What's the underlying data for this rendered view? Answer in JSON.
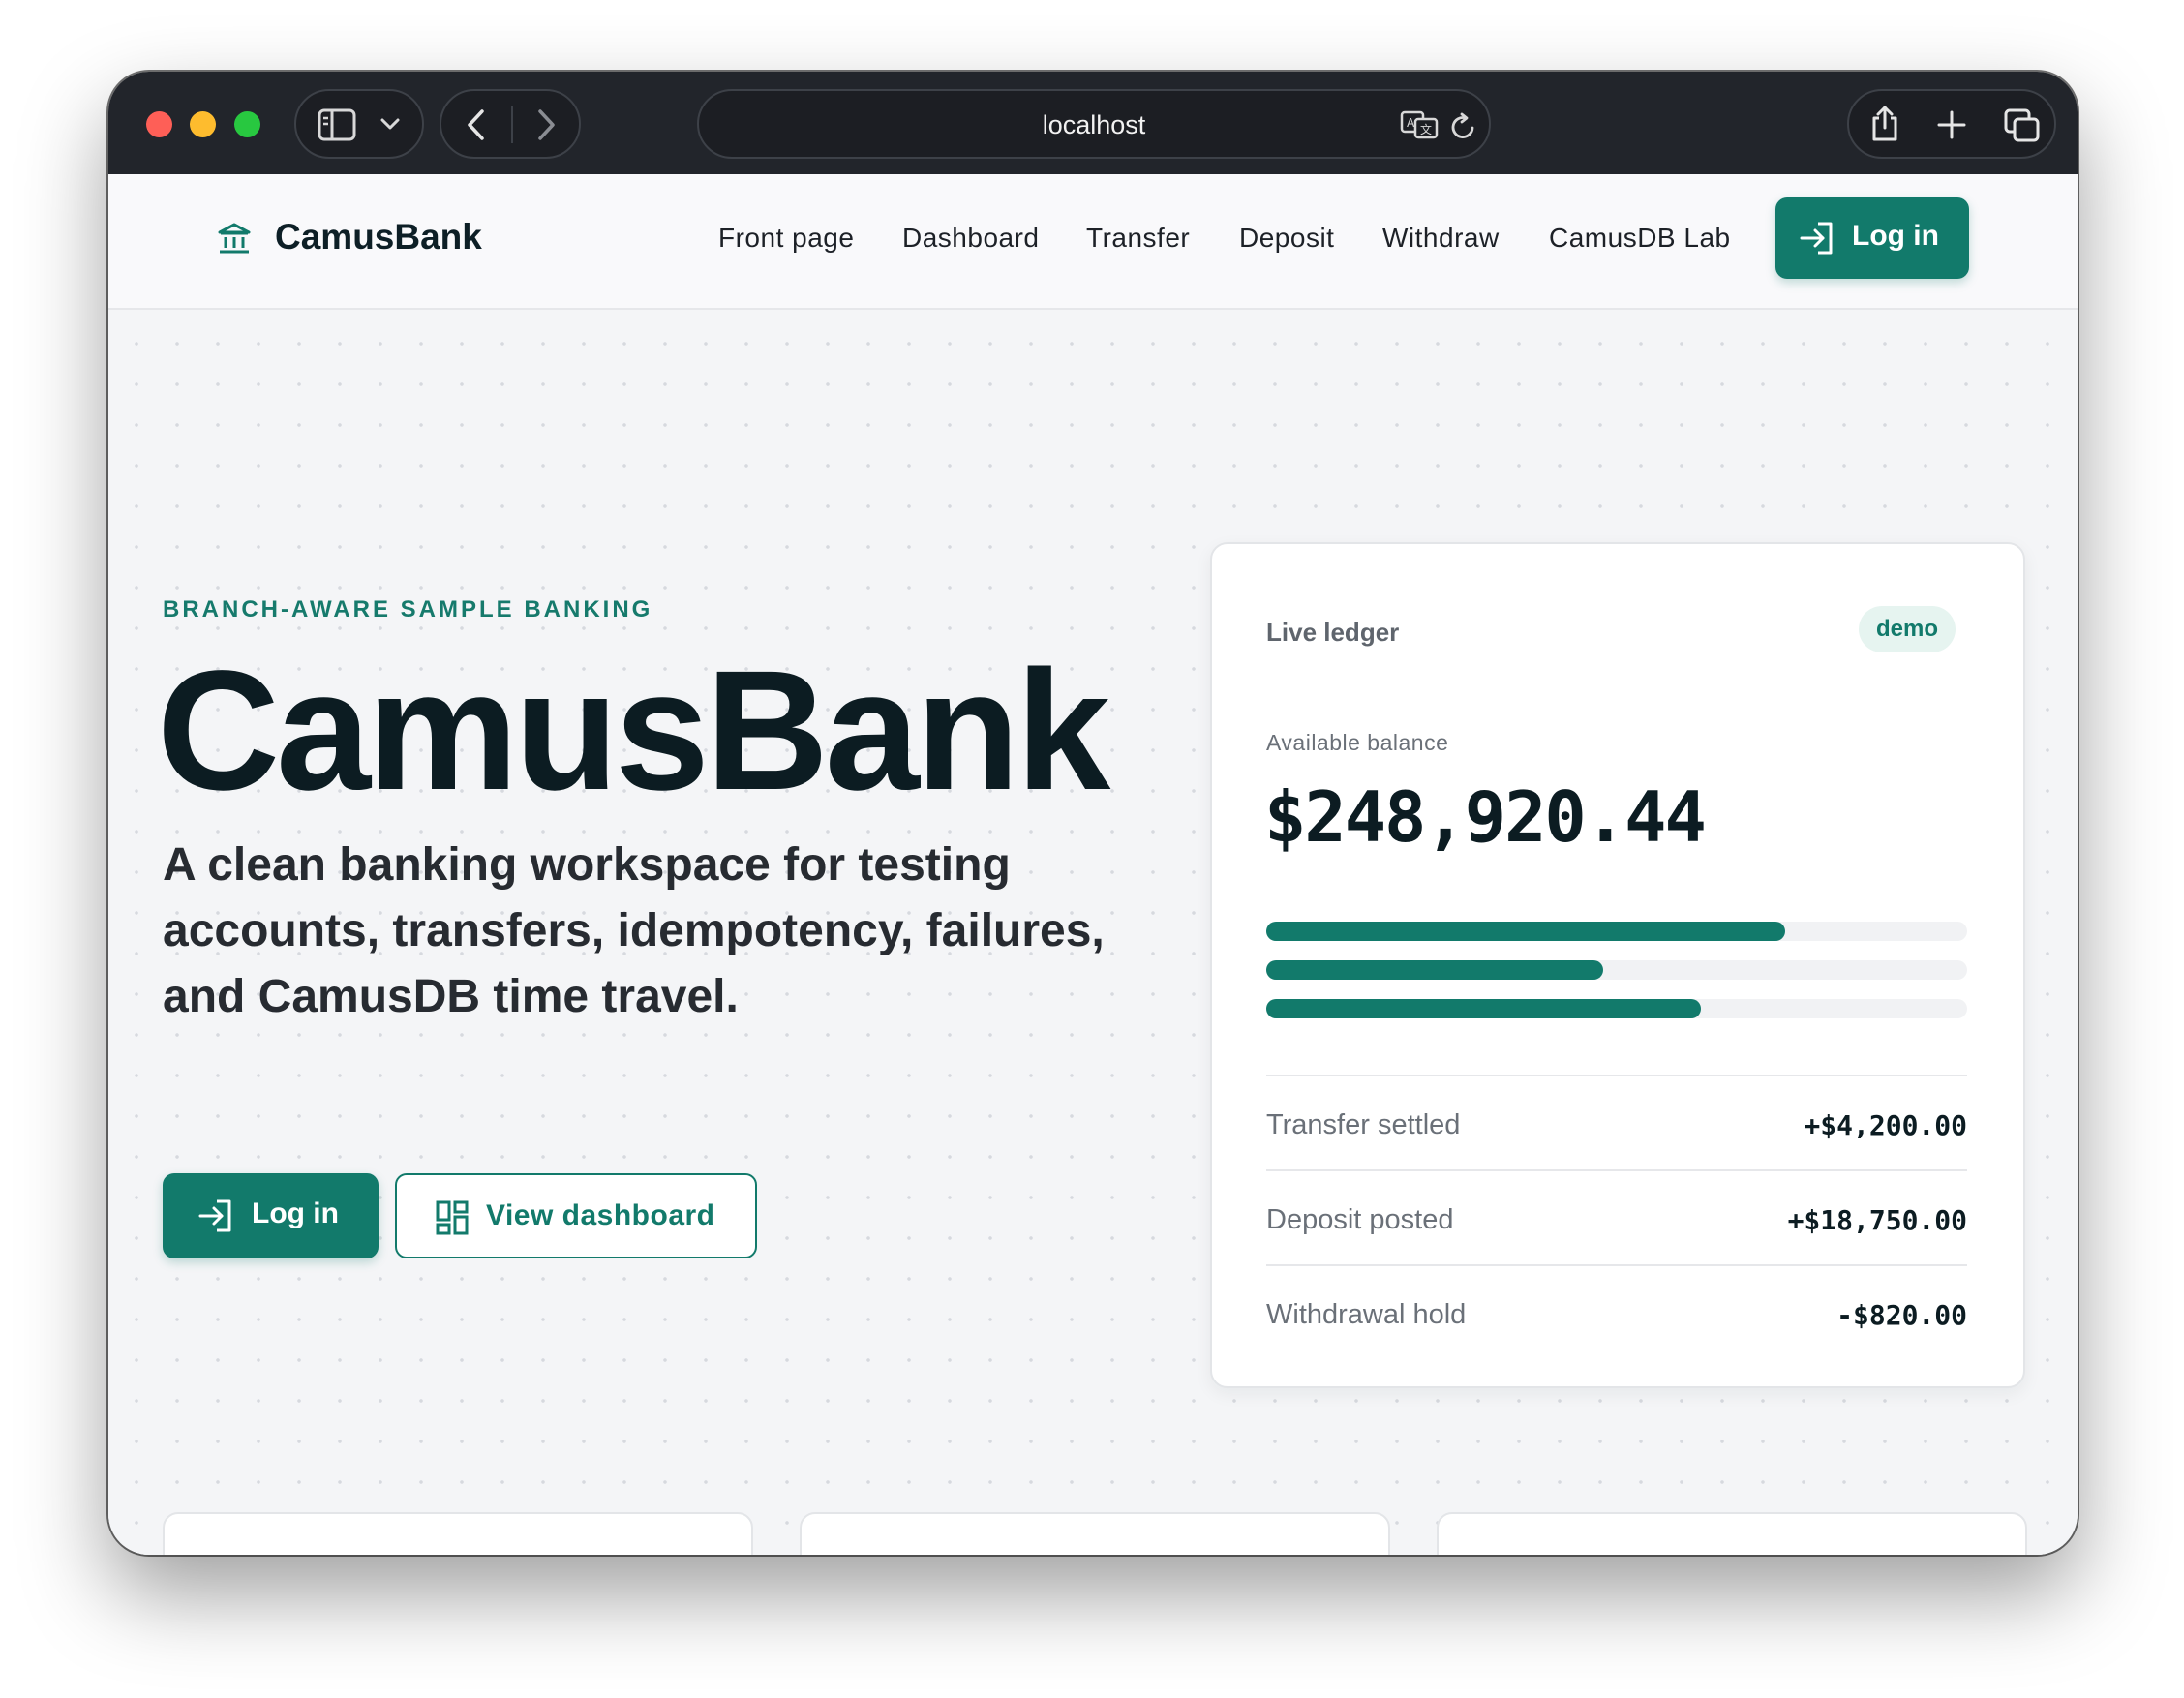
{
  "browser": {
    "url": "localhost",
    "icons": [
      "sidebar-icon",
      "chevron-down-icon",
      "back-icon",
      "forward-icon",
      "translate-icon",
      "reload-icon",
      "share-icon",
      "new-tab-icon",
      "tabs-overview-icon"
    ]
  },
  "nav": {
    "brand": "CamusBank",
    "links": [
      "Front page",
      "Dashboard",
      "Transfer",
      "Deposit",
      "Withdraw",
      "CamusDB Lab"
    ],
    "login_label": "Log in"
  },
  "hero": {
    "eyebrow": "BRANCH-AWARE SAMPLE BANKING",
    "title": "CamusBank",
    "subtitle": "A clean banking workspace for testing accounts, transfers, idempotency, failures, and CamusDB time travel.",
    "login_label": "Log in",
    "dashboard_label": "View dashboard"
  },
  "ledger": {
    "title": "Live ledger",
    "badge": "demo",
    "balance_label": "Available balance",
    "balance": "$248,920.44",
    "bars": [
      0.74,
      0.48,
      0.62
    ],
    "rows": [
      {
        "label": "Transfer settled",
        "amount": "+$4,200.00"
      },
      {
        "label": "Deposit posted",
        "amount": "+$18,750.00"
      },
      {
        "label": "Withdrawal hold",
        "amount": "-$820.00"
      }
    ]
  },
  "features": {
    "icons": [
      "transfer-arrows-icon",
      "network-icon",
      "receipt-icon"
    ]
  },
  "colors": {
    "accent": "#127a6b",
    "ink": "#0c1c22",
    "chrome": "#22252b",
    "page_bg": "#f4f5f7"
  }
}
